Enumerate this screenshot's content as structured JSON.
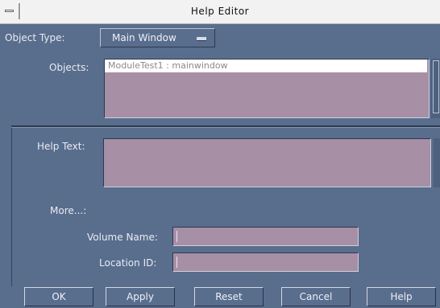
{
  "window": {
    "title": "Help Editor"
  },
  "object_type": {
    "label": "Object Type:",
    "value": "Main Window"
  },
  "objects": {
    "label": "Objects:",
    "items": [
      "ModuleTest1 : mainwindow"
    ]
  },
  "help_text": {
    "label": "Help Text:",
    "value": ""
  },
  "more": {
    "label": "More...:"
  },
  "volume_name": {
    "label": "Volume Name:",
    "value": ""
  },
  "location_id": {
    "label": "Location ID:",
    "value": ""
  },
  "buttons": {
    "ok": "OK",
    "apply": "Apply",
    "reset": "Reset",
    "cancel": "Cancel",
    "help": "Help"
  },
  "colors": {
    "background": "#596d8d",
    "field_background": "#a78fa6",
    "titlebar": "#f2f2f2"
  },
  "icons": {
    "window_menu": "window-menu-icon"
  }
}
